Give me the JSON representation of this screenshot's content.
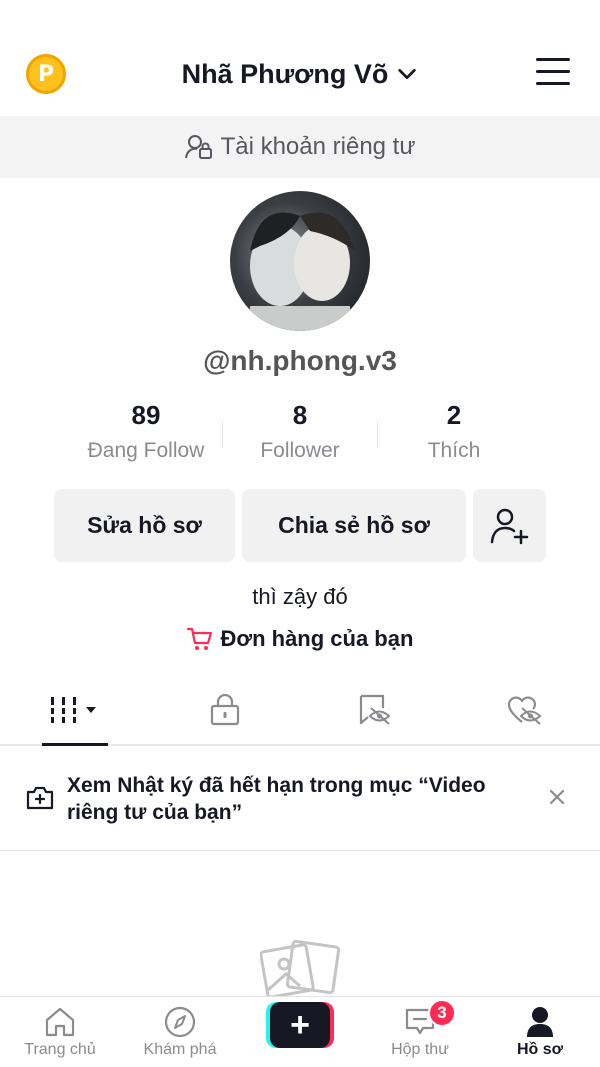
{
  "header": {
    "coin_glyph": "P",
    "display_name": "Nhã Phương Võ"
  },
  "private_banner": {
    "text": "Tài khoản riêng tư"
  },
  "profile": {
    "handle": "@nh.phong.v3",
    "bio": "thì zậy đó",
    "orders_label": "Đơn hàng của bạn"
  },
  "stats": [
    {
      "value": "89",
      "label": "Đang Follow"
    },
    {
      "value": "8",
      "label": "Follower"
    },
    {
      "value": "2",
      "label": "Thích"
    }
  ],
  "buttons": {
    "edit_profile": "Sửa hồ sơ",
    "share_profile": "Chia sẻ hồ sơ"
  },
  "notice": {
    "text": "Xem Nhật ký đã hết hạn trong mục “Video riêng tư của bạn”"
  },
  "bottom_nav": {
    "items": [
      {
        "label": "Trang chủ",
        "icon": "home-icon"
      },
      {
        "label": "Khám phá",
        "icon": "compass-icon"
      },
      {
        "label": "+",
        "icon": "plus-icon"
      },
      {
        "label": "Hộp thư",
        "icon": "inbox-icon",
        "badge": "3"
      },
      {
        "label": "Hồ sơ",
        "icon": "profile-icon",
        "active": true
      }
    ]
  },
  "colors": {
    "accent_red": "#fe2c55",
    "accent_cyan": "#25f4ee",
    "coin_yellow": "#ffc21c"
  }
}
